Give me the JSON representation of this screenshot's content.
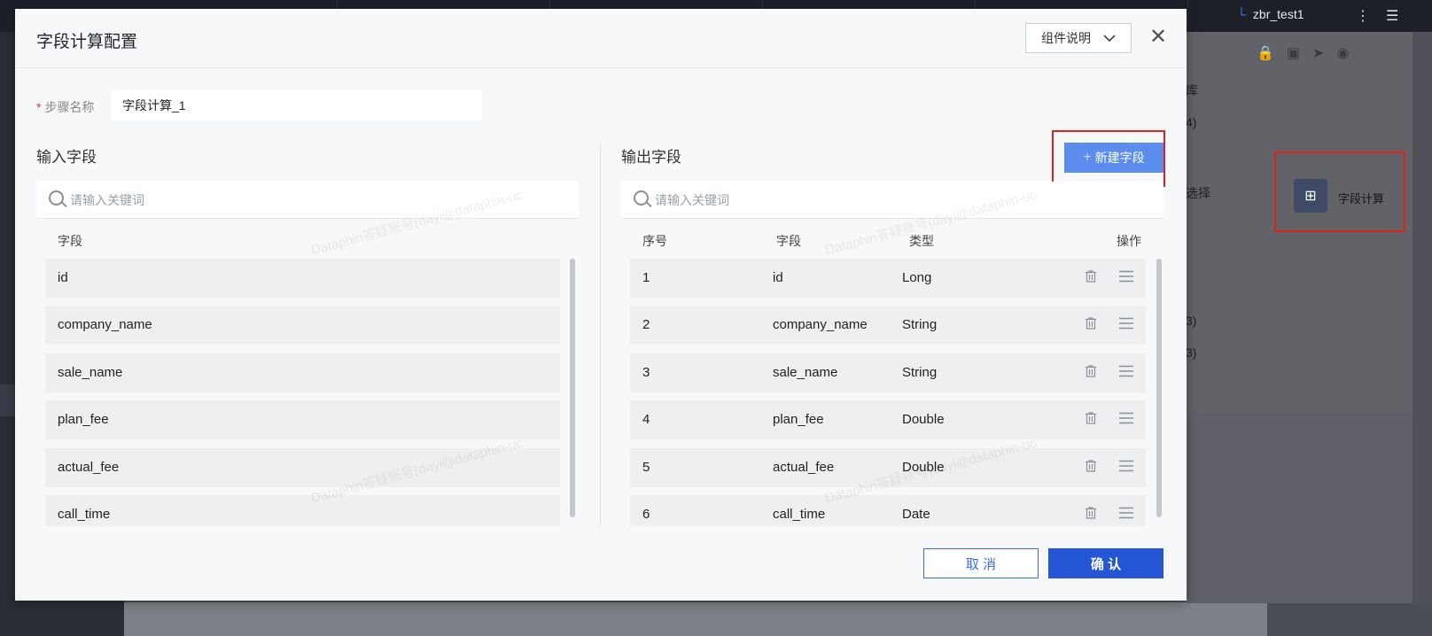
{
  "background": {
    "right_tab_label": "zbr_test1",
    "panel_texts": [
      "库",
      "4)",
      "选择",
      "3)",
      "3)"
    ],
    "node_label": "字段计算"
  },
  "modal": {
    "title": "字段计算配置",
    "help_button": "组件说明",
    "step_name_label": "步骤名称",
    "step_name_value": "字段计算_1",
    "input_section": {
      "title": "输入字段",
      "search_placeholder": "请输入关键词",
      "column_header": "字段",
      "rows": [
        "id",
        "company_name",
        "sale_name",
        "plan_fee",
        "actual_fee",
        "call_time"
      ]
    },
    "output_section": {
      "title": "输出字段",
      "new_field_button": "新建字段",
      "search_placeholder": "请输入关键词",
      "columns": {
        "index": "序号",
        "field": "字段",
        "type": "类型",
        "action": "操作"
      },
      "rows": [
        {
          "index": "1",
          "field": "id",
          "type": "Long"
        },
        {
          "index": "2",
          "field": "company_name",
          "type": "String"
        },
        {
          "index": "3",
          "field": "sale_name",
          "type": "String"
        },
        {
          "index": "4",
          "field": "plan_fee",
          "type": "Double"
        },
        {
          "index": "5",
          "field": "actual_fee",
          "type": "Double"
        },
        {
          "index": "6",
          "field": "call_time",
          "type": "Date"
        }
      ]
    },
    "cancel_button": "取 消",
    "confirm_button": "确 认",
    "watermark": "Dataphin答疑账号(dayi@dataphin-uc"
  },
  "colors": {
    "primary": "#2456d6",
    "new_button": "#5b8def",
    "highlight_box": "#e02020"
  }
}
